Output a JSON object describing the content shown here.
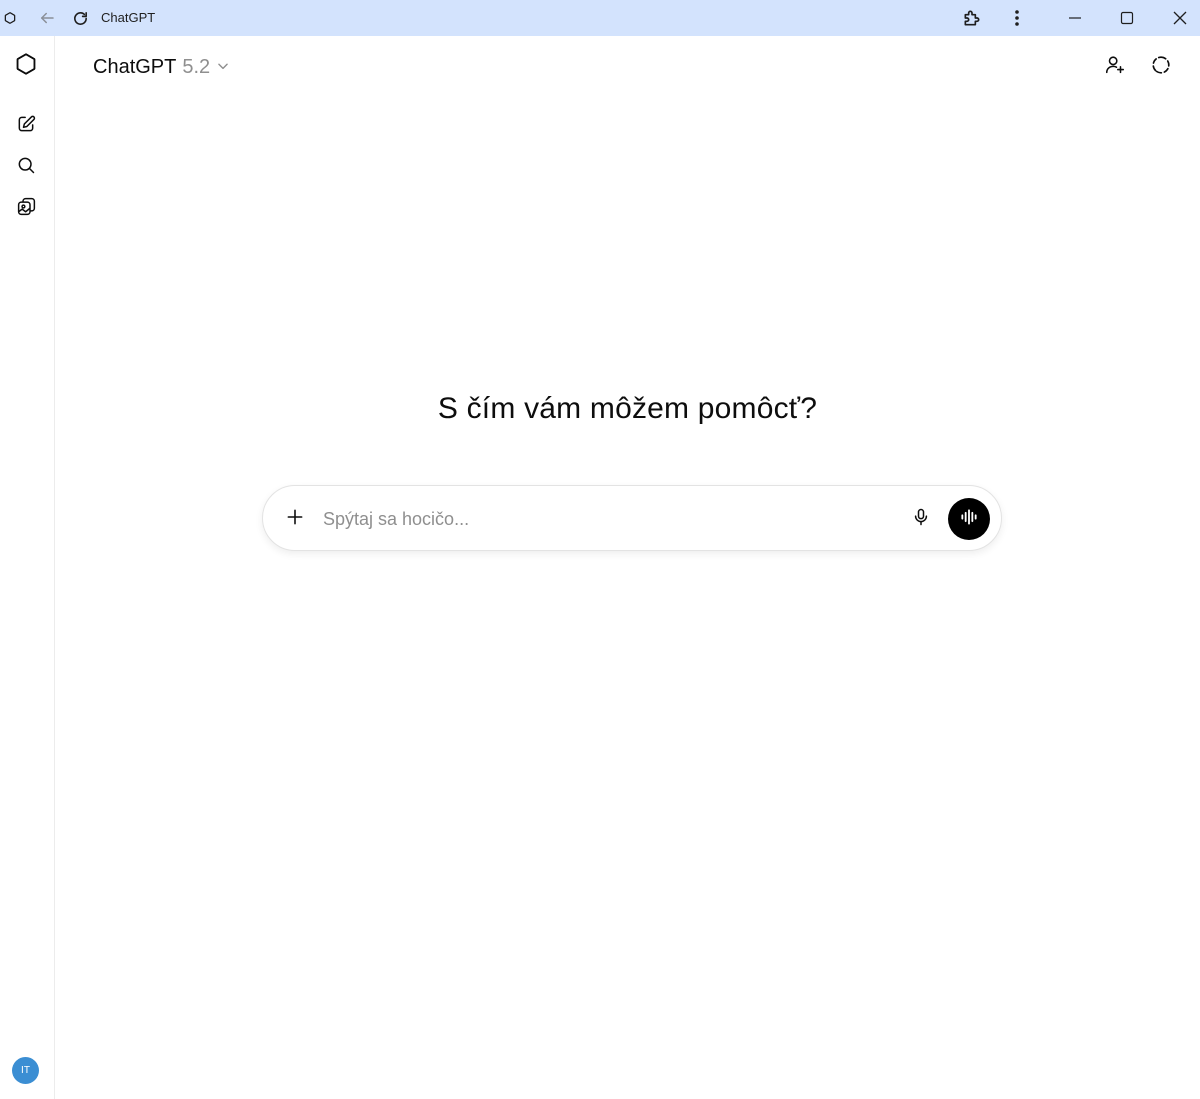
{
  "window": {
    "title": "ChatGPT",
    "icons": [
      "chatgpt-logo-icon",
      "back-arrow-icon",
      "reload-icon",
      "extensions-icon",
      "more-vert-icon",
      "minimize-icon",
      "maximize-icon",
      "close-icon"
    ]
  },
  "sidebar": {
    "items": [
      {
        "name": "new-chat",
        "icon": "compose-icon"
      },
      {
        "name": "search-chats",
        "icon": "search-icon"
      },
      {
        "name": "library",
        "icon": "images-icon"
      }
    ],
    "avatar_initials": "IT",
    "avatar_color": "#3b8ed3"
  },
  "header": {
    "model_name": "ChatGPT",
    "model_version": "5.2",
    "actions": [
      "add-person-icon",
      "temporary-chat-icon"
    ]
  },
  "main": {
    "headline": "S čím vám môžem pomôcť?",
    "composer": {
      "placeholder": "Spýtaj sa hocičo...",
      "value": ""
    }
  },
  "colors": {
    "titlebar_bg": "#d3e3fd",
    "voice_button_bg": "#000000"
  }
}
